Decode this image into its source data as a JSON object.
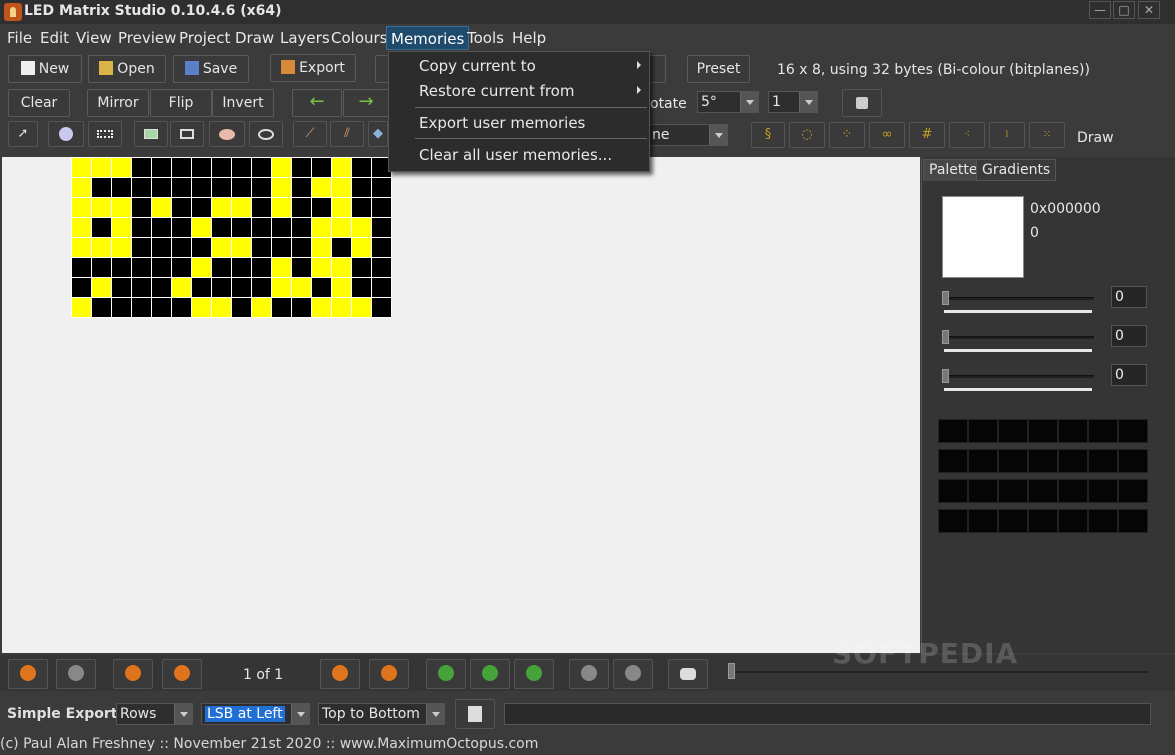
{
  "window": {
    "title": "LED Matrix Studio 0.10.4.6 (x64)"
  },
  "menu": [
    "File",
    "Edit",
    "View",
    "Preview",
    "Project",
    "Draw",
    "Layers",
    "Colours",
    "Memories",
    "Tools",
    "Help"
  ],
  "toolbar1": {
    "new": "New",
    "open": "Open",
    "save": "Save",
    "export": "Export",
    "preset": "Preset",
    "info": "16 x 8, using 32 bytes (Bi-colour (bitplanes))"
  },
  "toolbar2": {
    "clear": "Clear",
    "mirror": "Mirror",
    "flip": "Flip",
    "invert": "Invert",
    "rotate_label": "otate",
    "rotate_value": "5°",
    "count_value": "1"
  },
  "toolbar3": {
    "mode_value": "ne",
    "draw_label": "Draw"
  },
  "memories_menu": {
    "copy": "Copy current to",
    "restore": "Restore current from",
    "export": "Export user memories",
    "clear": "Clear all user memories..."
  },
  "matrix": {
    "on_color": "#ffff00",
    "off_color": "#000000",
    "rows": [
      "1110000000100100",
      "1000000000101100",
      "1110100110100100",
      "1010001000001110",
      "1110000110001010",
      "0000001000101100",
      "0100010000110100",
      "1000001101001110"
    ]
  },
  "palette": {
    "tab_palette": "Palette",
    "tab_gradients": "Gradients",
    "hex": "0x000000",
    "dec": "0",
    "r": "0",
    "g": "0",
    "b": "0"
  },
  "playback": {
    "frame": "1 of 1"
  },
  "simple_export": {
    "label": "Simple Export",
    "rows": "Rows",
    "lsb": "LSB at Left",
    "direction": "Top to Bottom"
  },
  "footer": "(c) Paul Alan Freshney :: November 21st 2020 :: www.MaximumOctopus.com",
  "watermark": "SOFTPEDIA"
}
